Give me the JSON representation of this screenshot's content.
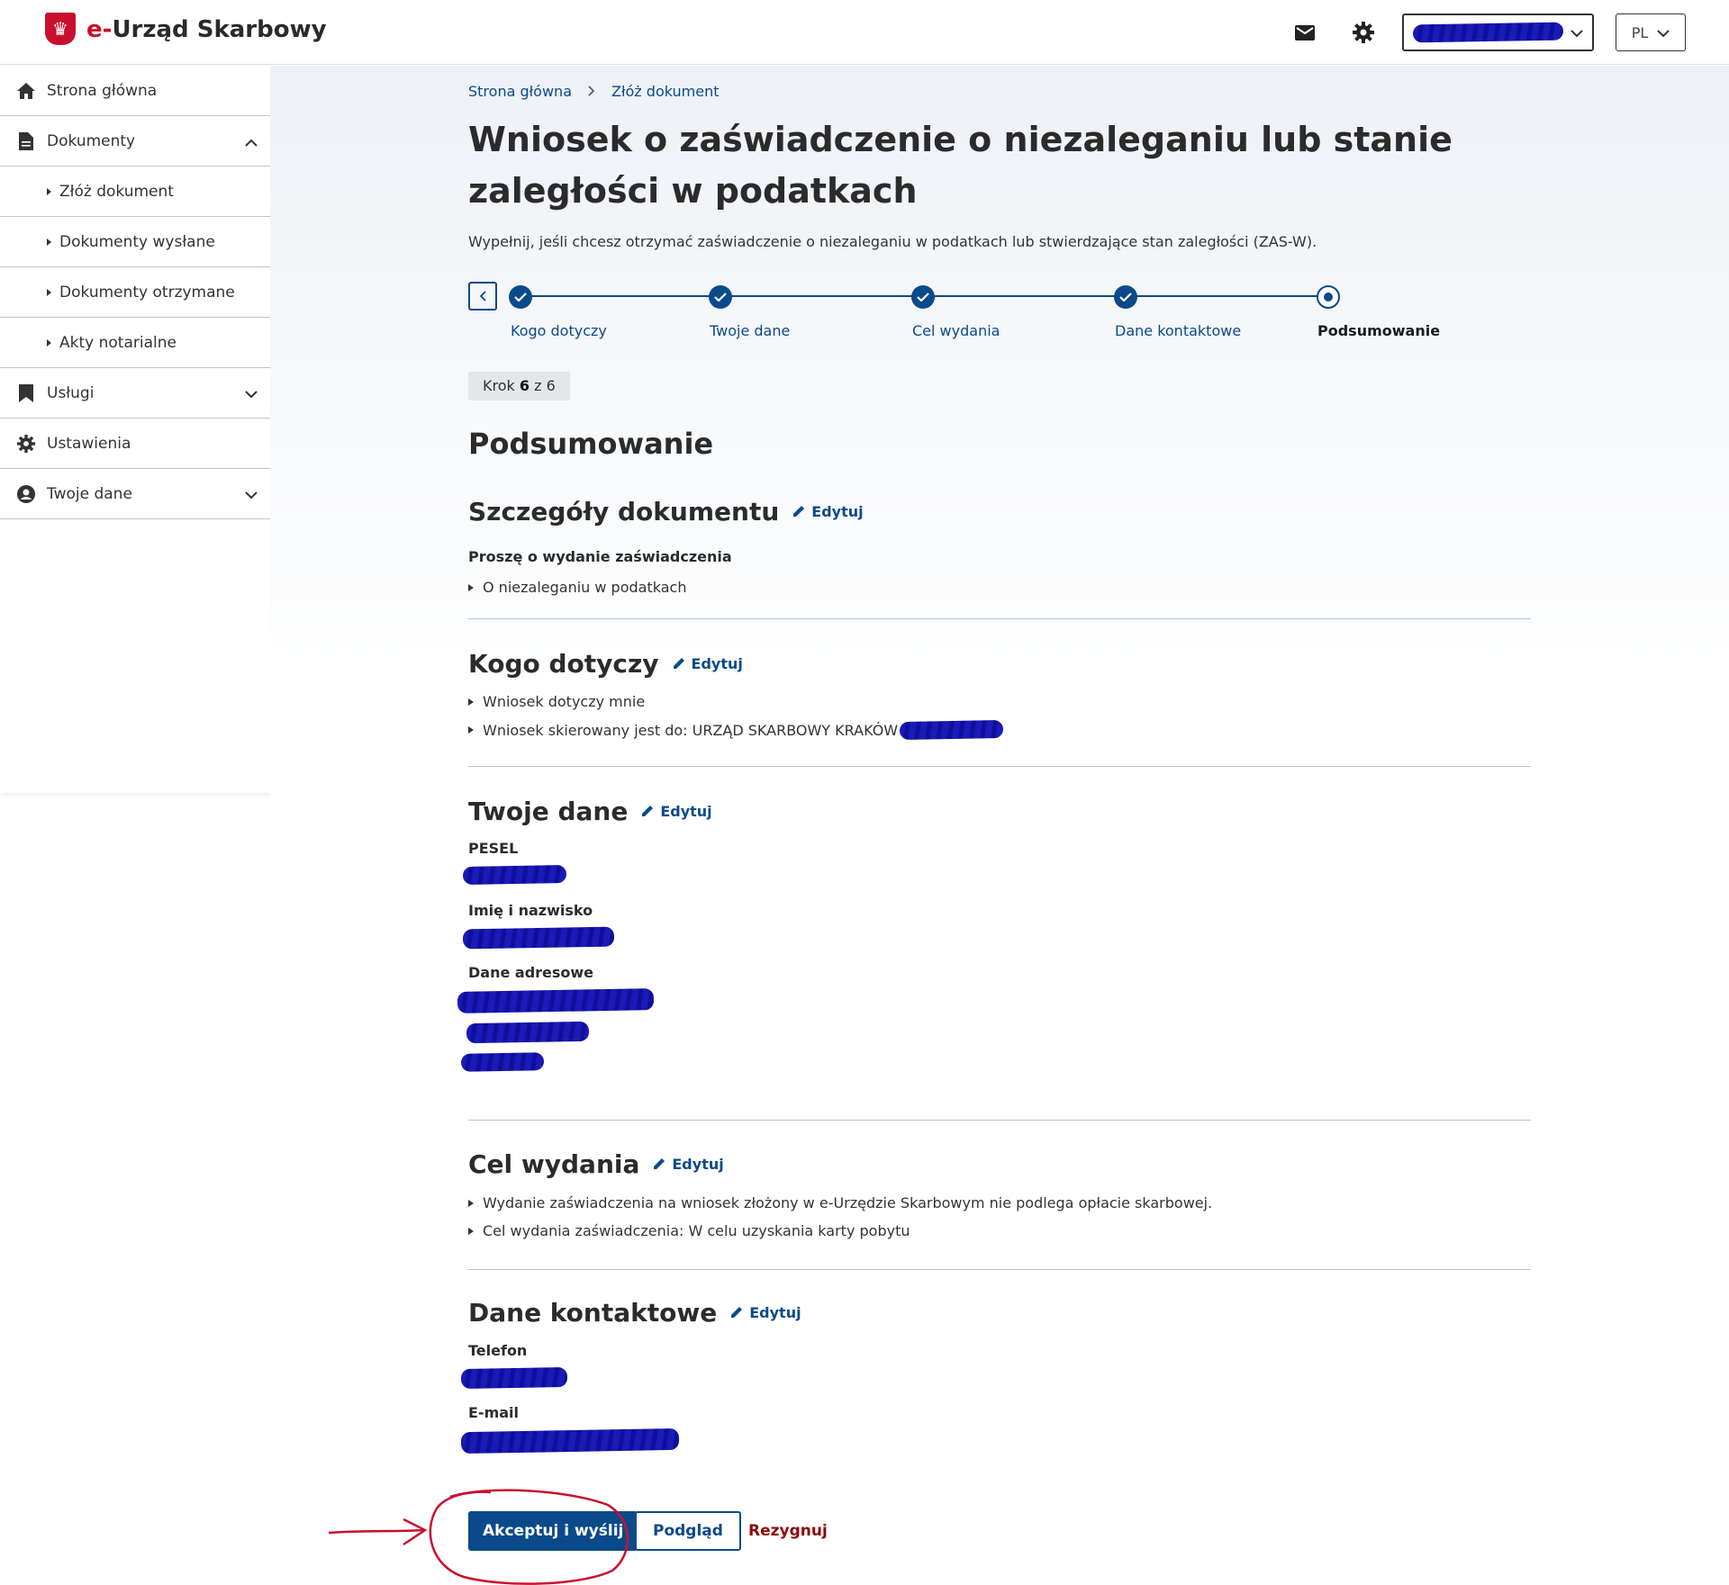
{
  "header": {
    "brand_prefix": "e-",
    "brand_name": "Urząd Skarbowy",
    "icons": [
      "mail-icon",
      "gear-icon"
    ],
    "language": "PL"
  },
  "sidebar": {
    "items": [
      {
        "label": "Strona główna",
        "icon": "home-icon"
      },
      {
        "label": "Dokumenty",
        "icon": "document-icon",
        "expanded": true,
        "children": [
          {
            "label": "Złóż dokument"
          },
          {
            "label": "Dokumenty wysłane"
          },
          {
            "label": "Dokumenty otrzymane"
          },
          {
            "label": "Akty notarialne"
          }
        ]
      },
      {
        "label": "Usługi",
        "icon": "bookmark-icon"
      },
      {
        "label": "Ustawienia",
        "icon": "gear-icon"
      },
      {
        "label": "Twoje dane",
        "icon": "user-icon"
      }
    ]
  },
  "breadcrumb": [
    "Strona główna",
    "Złóż dokument"
  ],
  "page": {
    "title": "Wniosek o zaświadczenie o niezaleganiu lub stanie zaległości w podatkach",
    "intro": "Wypełnij, jeśli chcesz otrzymać zaświadczenie o niezaleganiu w podatkach lub stwierdzające stan zaległości (ZAS-W)."
  },
  "stepper": {
    "steps": [
      "Kogo dotyczy",
      "Twoje dane",
      "Cel wydania",
      "Dane kontaktowe",
      "Podsumowanie"
    ],
    "current_index": 4,
    "step_label": "Krok",
    "step_current": "6",
    "step_of": "z 6"
  },
  "summary": {
    "heading": "Podsumowanie",
    "edit_label": "Edytuj",
    "details": {
      "heading": "Szczegóły dokumentu",
      "label": "Proszę o wydanie zaświadczenia",
      "items": [
        "O niezaleganiu w podatkach"
      ]
    },
    "concerns": {
      "heading": "Kogo dotyczy",
      "items": [
        "Wniosek dotyczy mnie",
        "Wniosek skierowany jest do: URZĄD SKARBOWY KRAKÓW"
      ]
    },
    "your_data": {
      "heading": "Twoje dane",
      "pesel_label": "PESEL",
      "name_label": "Imię i nazwisko",
      "address_label": "Dane adresowe"
    },
    "purpose": {
      "heading": "Cel wydania",
      "items": [
        "Wydanie zaświadczenia na wniosek złożony w e-Urzędzie Skarbowym nie podlega opłacie skarbowej.",
        "Cel wydania zaświadczenia: W celu uzyskania karty pobytu"
      ]
    },
    "contact": {
      "heading": "Dane kontaktowe",
      "phone_label": "Telefon",
      "email_label": "E-mail"
    }
  },
  "actions": {
    "submit": "Akceptuj i wyślij",
    "preview": "Podgląd",
    "cancel": "Rezygnuj"
  },
  "colors": {
    "primary": "#0b4a8a",
    "brand_red": "#c8102e",
    "cancel": "#8a0a0a",
    "redaction": "#1a1ab8",
    "annotation": "#c8102e"
  }
}
